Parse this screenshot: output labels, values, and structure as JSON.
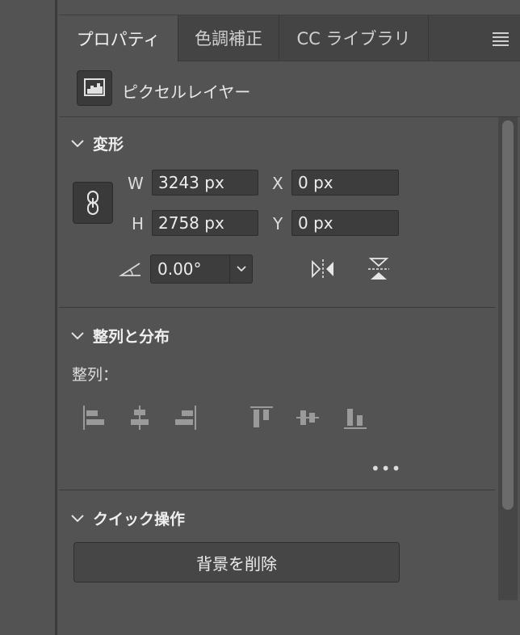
{
  "tabs": [
    {
      "label": "プロパティ",
      "active": true
    },
    {
      "label": "色調補正",
      "active": false
    },
    {
      "label": "CC ライブラリ",
      "active": false
    }
  ],
  "menu_icon": "hamburger-menu-icon",
  "layer": {
    "type_label": "ピクセルレイヤー",
    "icon": "pixel-layer-icon"
  },
  "transform": {
    "title": "変形",
    "w_label": "W",
    "w_value": "3243 px",
    "h_label": "H",
    "h_value": "2758 px",
    "x_label": "X",
    "x_value": "0 px",
    "y_label": "Y",
    "y_value": "0 px",
    "angle_value": "0.00°",
    "link_icon": "link-icon",
    "flip_h_icon": "flip-horizontal-icon",
    "flip_v_icon": "flip-vertical-icon"
  },
  "align": {
    "title": "整列と分布",
    "sub_label": "整列：",
    "icons": [
      "align-left-edges-icon",
      "align-horizontal-centers-icon",
      "align-right-edges-icon",
      "align-top-edges-icon",
      "align-vertical-centers-icon",
      "align-bottom-edges-icon"
    ],
    "more": "•••"
  },
  "quick_actions": {
    "title": "クイック操作",
    "remove_bg_label": "背景を削除"
  },
  "colors": {
    "panel_bg": "#535353",
    "tab_bg": "#444444",
    "field_bg": "#3d3d3d",
    "text": "#e6e6e6"
  }
}
